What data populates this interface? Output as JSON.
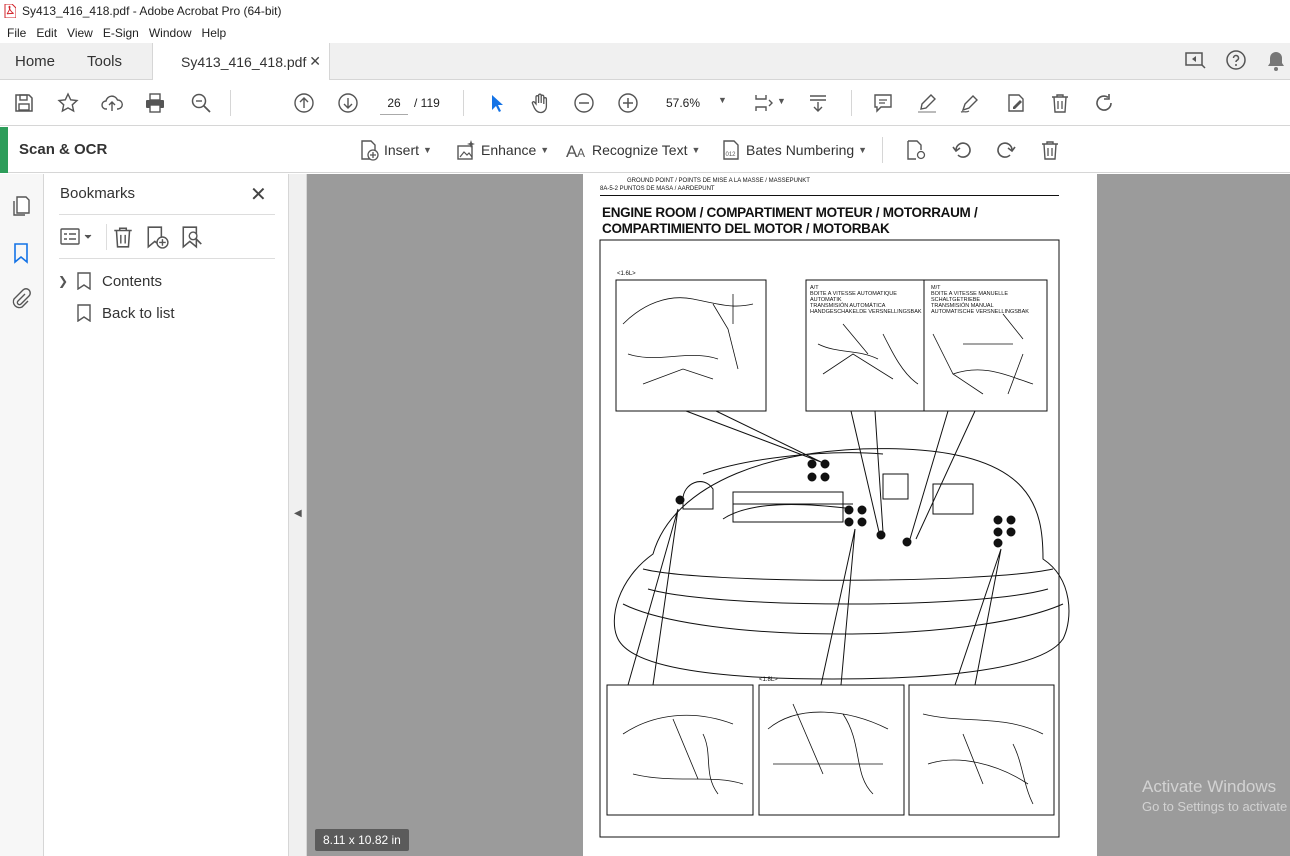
{
  "window": {
    "title": "Sy413_416_418.pdf - Adobe Acrobat Pro (64-bit)"
  },
  "menu": [
    "File",
    "Edit",
    "View",
    "E-Sign",
    "Window",
    "Help"
  ],
  "tabs": {
    "home": "Home",
    "tools": "Tools",
    "document": "Sy413_416_418.pdf"
  },
  "toolbar": {
    "current_page": "26",
    "total_pages": "/ 119",
    "zoom": "57.6%"
  },
  "scan_ocr": {
    "title": "Scan & OCR",
    "insert": "Insert",
    "enhance": "Enhance",
    "recognize_text": "Recognize Text",
    "bates_numbering": "Bates Numbering"
  },
  "bookmarks": {
    "title": "Bookmarks",
    "items": [
      {
        "label": "Contents"
      },
      {
        "label": "Back to list"
      }
    ]
  },
  "document_page": {
    "header_line1": "GROUND POINT / POINTS DE MISE A LA MASSE / MASSEPUNKT",
    "header_line2": "8A-5-2 PUNTOS DE MASA / AARDEPUNT",
    "title_line1": "ENGINE ROOM / COMPARTIMENT MOTEUR / MOTORRAUM /",
    "title_line2": "COMPARTIMIENTO DEL MOTOR / MOTORBAK",
    "label_16l_top": "<1.6L>",
    "at_label": "A/T",
    "at_lines": [
      "BOITE A VITESSE AUTOMATIQUE",
      "AUTOMATIK",
      "TRANSMISIÓN AUTOMÁTICA",
      "HANDGESCHAKELDE VERSNELLINGSBAK"
    ],
    "mt_label": "M/T",
    "mt_lines": [
      "BOITE A VITESSE MANUELLE",
      "SCHALTGETRIEBE",
      "TRANSMISIÓN MANUAL",
      "AUTOMATISCHE VERSNELLINGSBAK"
    ],
    "label_18l_bottom": "<1.8L>"
  },
  "page_size": "8.11 x 10.82 in",
  "watermark": {
    "line1": "Activate Windows",
    "line2": "Go to Settings to activate Windows."
  }
}
